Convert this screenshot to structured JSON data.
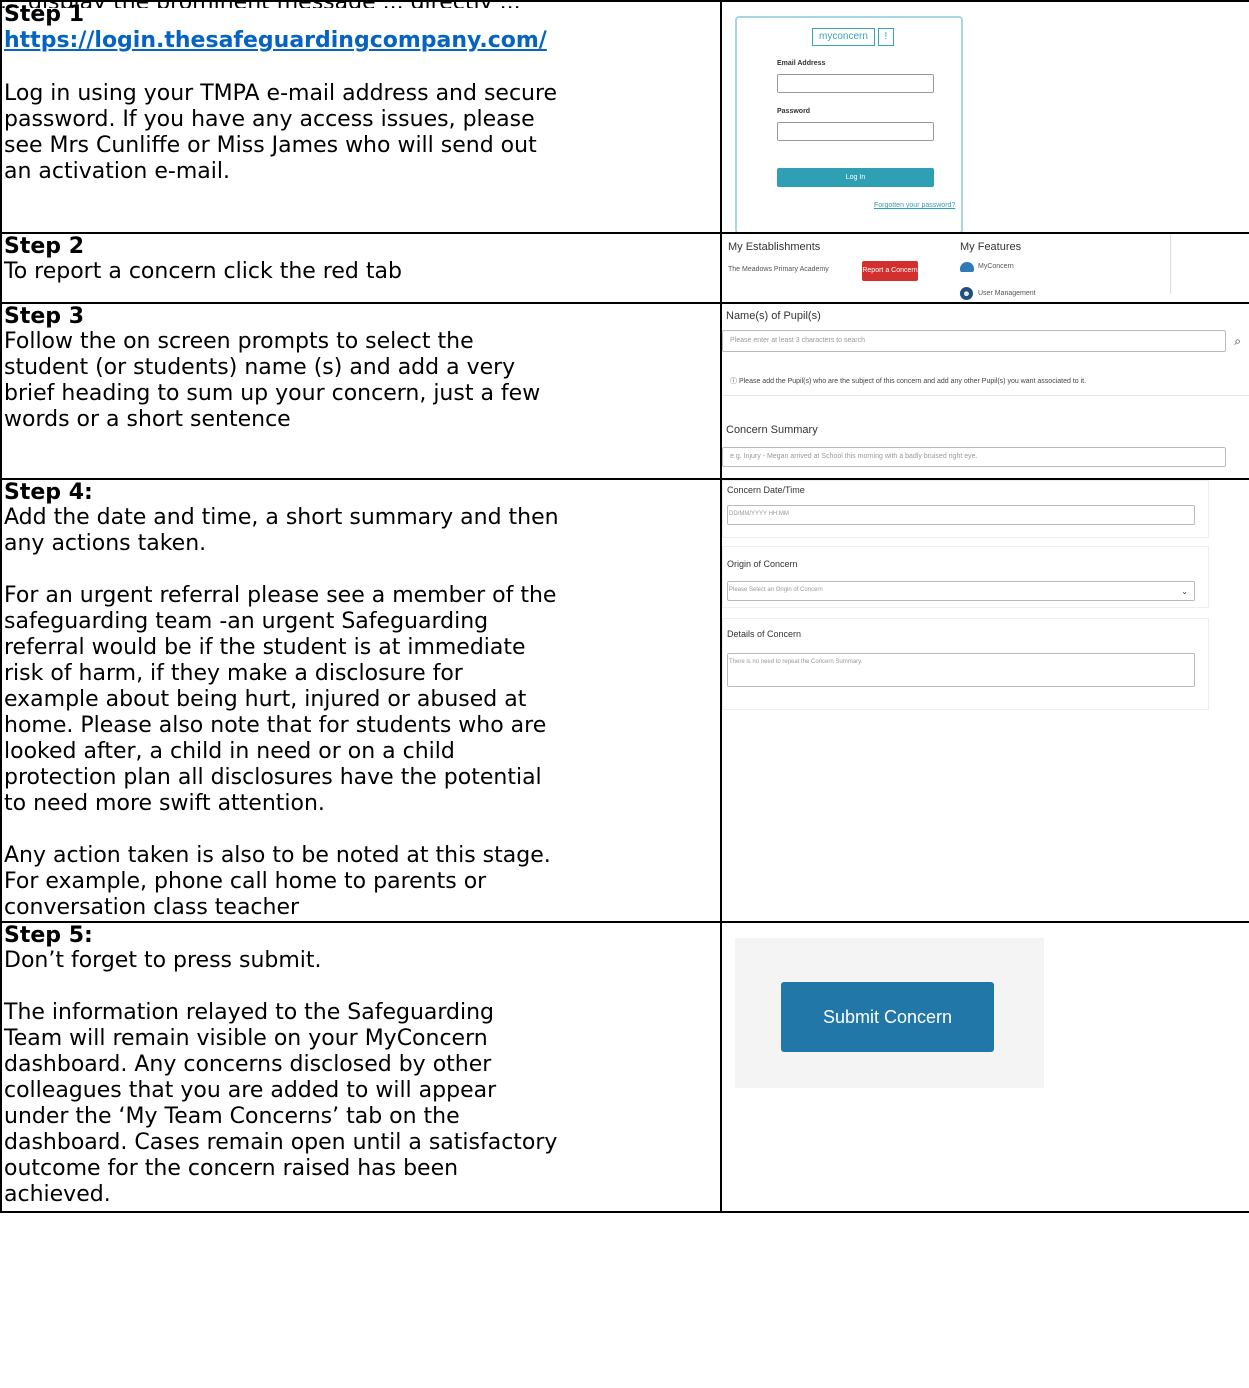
{
  "header_fragment": "... display the prominent message ... directly ...",
  "steps": [
    {
      "title": "Step 1",
      "link": "https://login.thesafeguardingcompany.com/",
      "lines": [
        "Log in using your TMPA e-mail address and secure",
        "password. If you have any access issues, please",
        "see Mrs Cunliffe or Miss James who will send out",
        "an activation e-mail."
      ],
      "image": {
        "logo_word": "myconcern",
        "logo_mark": "!",
        "email_label": "Email Address",
        "password_label": "Password",
        "button_label": "Log In",
        "forgot_label": "Forgotten your password?"
      }
    },
    {
      "title": "Step 2",
      "lines": [
        "To report a concern click the red tab"
      ],
      "image": {
        "establishments_heading": "My Establishments",
        "establishment_name": "The Meadows Primary Academy",
        "report_button": "Report a Concern",
        "features_heading": "My Features",
        "feature_1": "MyConcern",
        "feature_2": "User Management"
      }
    },
    {
      "title": "Step 3",
      "lines": [
        "Follow the on screen prompts to select the",
        "student (or students) name (s) and add a very",
        "brief heading to sum up your concern, just a few",
        "words or a short sentence"
      ],
      "image": {
        "pupils_heading": "Name(s) of Pupil(s)",
        "search_placeholder": "Please enter at least 3 characters to search",
        "info_text": "Please add the Pupil(s) who are the subject of this concern and add any other Pupil(s) you want associated to it.",
        "summary_heading": "Concern Summary",
        "summary_placeholder": "e.g. Injury - Megan arrived at School this morning with a badly bruised right eye."
      }
    },
    {
      "title": "Step 4:",
      "paragraph_1": [
        "Add the date and time, a short summary and then",
        "any actions taken."
      ],
      "paragraph_2": [
        "For an urgent referral please see a member of the",
        "safeguarding team -an urgent Safeguarding",
        "referral would be if the student is at immediate",
        "risk of harm, if they make a disclosure for",
        "example about being hurt, injured or abused at",
        "home. Please also note that for students who are",
        "looked after, a child in need or on a child",
        "protection plan all disclosures have the potential",
        "to need more swift attention."
      ],
      "paragraph_3": [
        "Any action taken is also to be noted at this stage.",
        "For example, phone call home to parents or",
        "conversation class teacher"
      ],
      "image": {
        "datetime_heading": "Concern Date/Time",
        "datetime_placeholder": "DD/MM/YYYY HH:MM",
        "origin_heading": "Origin of Concern",
        "origin_placeholder": "Please Select an Origin of Concern",
        "details_heading": "Details of Concern",
        "details_placeholder": "There is no need to repeat the Concern Summary."
      }
    },
    {
      "title": "Step 5:",
      "paragraph_1": [
        "Don’t forget to press submit."
      ],
      "paragraph_2": [
        "The information relayed to the Safeguarding",
        "Team will remain visible on your MyConcern",
        "dashboard. Any concerns disclosed by other",
        "colleagues that you are added to will appear",
        "under the ‘My Team Concerns’ tab on the",
        "dashboard. Cases remain open until a satisfactory",
        "outcome for the concern raised has been",
        "achieved."
      ],
      "image": {
        "button_label": "Submit Concern"
      }
    }
  ]
}
